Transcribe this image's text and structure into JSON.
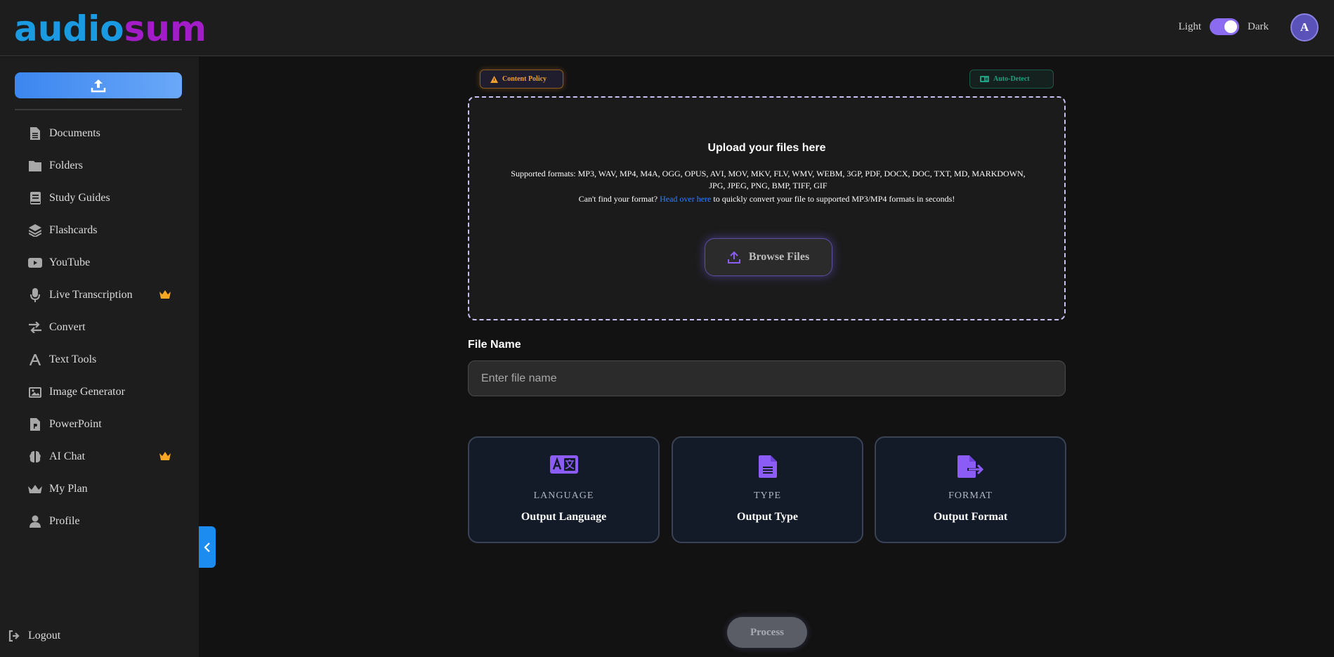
{
  "header": {
    "logo_part1": "audio",
    "logo_part2": "sum",
    "theme_light": "Light",
    "theme_dark": "Dark",
    "avatar_initial": "A"
  },
  "sidebar": {
    "items": [
      {
        "label": "Documents",
        "icon": "document-icon"
      },
      {
        "label": "Folders",
        "icon": "folder-icon"
      },
      {
        "label": "Study Guides",
        "icon": "book-icon"
      },
      {
        "label": "Flashcards",
        "icon": "layers-icon"
      },
      {
        "label": "YouTube",
        "icon": "youtube-icon"
      },
      {
        "label": "Live Transcription",
        "icon": "microphone-icon",
        "premium": true
      },
      {
        "label": "Convert",
        "icon": "swap-arrows-icon"
      },
      {
        "label": "Text Tools",
        "icon": "font-icon"
      },
      {
        "label": "Image Generator",
        "icon": "image-icon"
      },
      {
        "label": "PowerPoint",
        "icon": "powerpoint-file-icon"
      },
      {
        "label": "AI Chat",
        "icon": "brain-icon",
        "premium": true
      },
      {
        "label": "My Plan",
        "icon": "crown-icon"
      },
      {
        "label": "Profile",
        "icon": "user-icon"
      }
    ],
    "logout": "Logout"
  },
  "main": {
    "content_policy": "Content Policy",
    "auto_detect": "Auto-Detect",
    "upload_title": "Upload your files here",
    "formats": "Supported formats: MP3, WAV, MP4, M4A, OGG, OPUS, AVI, MOV, MKV, FLV, WMV, WEBM, 3GP, PDF, DOCX, DOC, TXT, MD, MARKDOWN, JPG, JPEG, PNG, BMP, TIFF, GIF",
    "help_prefix": "Can't find your format?",
    "help_link": "Head over here",
    "help_suffix": "to quickly convert your file to supported MP3/MP4 formats in seconds!",
    "browse": "Browse Files",
    "file_name_label": "File Name",
    "file_name_placeholder": "Enter file name",
    "file_name_value": "",
    "cards": [
      {
        "top": "LANGUAGE",
        "main": "Output Language",
        "icon": "translate-icon"
      },
      {
        "top": "TYPE",
        "main": "Output Type",
        "icon": "file-text-icon"
      },
      {
        "top": "FORMAT",
        "main": "Output Format",
        "icon": "file-export-icon"
      }
    ],
    "process": "Process"
  },
  "colors": {
    "accent_purple": "#8b5cf6",
    "accent_blue": "#1d8cf0",
    "crown": "#f5a623"
  }
}
